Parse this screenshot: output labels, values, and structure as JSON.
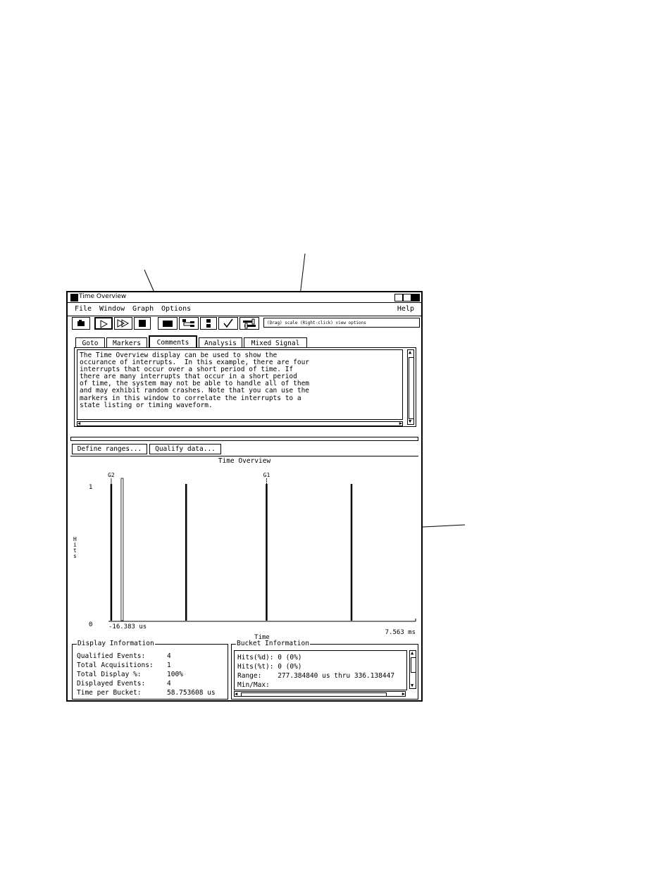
{
  "window": {
    "title": "Time Overview",
    "menu": {
      "file": "File",
      "window": "Window",
      "graph": "Graph",
      "options": "Options",
      "help": "Help"
    },
    "status_message": "(Drag) scale (Right-click) view options",
    "toolbar_icons": [
      "open-icon",
      "run-icon",
      "run-repetitive-icon",
      "stop-icon",
      "window-icon",
      "tree-icon",
      "list-icon",
      "check-icon",
      "settings-icon"
    ]
  },
  "tabs": [
    {
      "label": "Goto"
    },
    {
      "label": "Markers"
    },
    {
      "label": "Comments",
      "active": true
    },
    {
      "label": "Analysis"
    },
    {
      "label": "Mixed Signal"
    }
  ],
  "comments": {
    "text": "The Time Overview display can be used to show the\noccurance of interrupts.  In this example, there are four\ninterrupts that occur over a short period of time. If\nthere are many interrupts that occur in a short period\nof time, the system may not be able to handle all of them\nand may exhibit random crashes. Note that you can use the\nmarkers in this window to correlate the interrupts to a\nstate listing or timing waveform."
  },
  "buttons": {
    "define_ranges": "Define ranges...",
    "qualify_data": "Qualify data..."
  },
  "chart_data": {
    "type": "bar",
    "title": "Time Overview",
    "xlabel": "Time",
    "ylabel": "Hits",
    "x_start_label": "-16.383 us",
    "x_end_label": "7.563 ms",
    "y_tick_labels": [
      "1",
      "0"
    ],
    "ylim": [
      0,
      1
    ],
    "x_unit": "ms",
    "xlim": [
      -0.016383,
      7.563
    ],
    "bars": [
      {
        "x": 0.0,
        "value": 1
      },
      {
        "x": 1.86,
        "value": 1
      },
      {
        "x": 3.86,
        "value": 1
      },
      {
        "x": 5.97,
        "value": 1
      }
    ],
    "markers": [
      {
        "label": "G2",
        "x": 0.0
      },
      {
        "label": "G1",
        "x": 3.86
      }
    ]
  },
  "display_info": {
    "legend": "Display Information",
    "rows": [
      {
        "label": "Qualified Events:",
        "value": "4"
      },
      {
        "label": "Total Acquisitions:",
        "value": "1"
      },
      {
        "label": "Total Display %:",
        "value": "100%"
      },
      {
        "label": "Displayed Events:",
        "value": "4"
      },
      {
        "label": "Time per Bucket:",
        "value": "58.753608 us"
      }
    ]
  },
  "bucket_info": {
    "legend": "Bucket Information",
    "lines": [
      "Hits(%d): 0 (0%)",
      "Hits(%t): 0 (0%)",
      "Range:    277.384840 us thru 336.138447",
      "Min/Max:"
    ]
  }
}
